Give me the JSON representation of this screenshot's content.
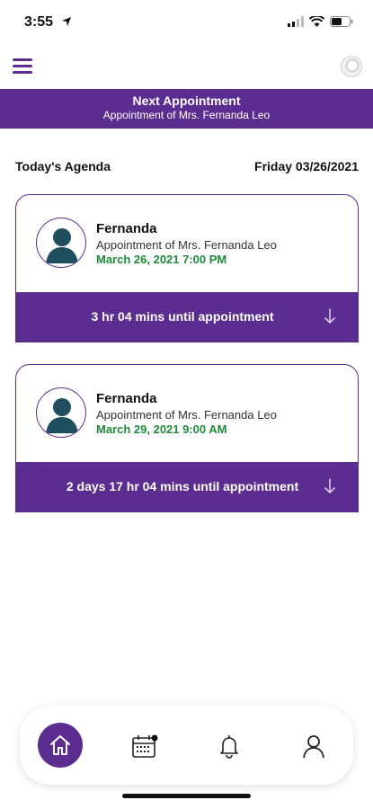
{
  "status_bar": {
    "time": "3:55"
  },
  "banner": {
    "title": "Next Appointment",
    "subtitle": "Appointment of Mrs. Fernanda Leo"
  },
  "agenda": {
    "label": "Today's Agenda",
    "date": "Friday 03/26/2021"
  },
  "appointments": [
    {
      "name": "Fernanda",
      "subtitle": "Appointment of Mrs. Fernanda Leo",
      "datetime": "March 26, 2021 7:00 PM",
      "countdown": "3 hr 04 mins until appointment"
    },
    {
      "name": "Fernanda",
      "subtitle": "Appointment of Mrs. Fernanda Leo",
      "datetime": "March 29, 2021 9:00 AM",
      "countdown": "2 days 17 hr 04 mins until appointment"
    }
  ],
  "nav": {
    "items": [
      {
        "icon": "home-icon",
        "active": true
      },
      {
        "icon": "calendar-icon",
        "active": false
      },
      {
        "icon": "bell-icon",
        "active": false
      },
      {
        "icon": "user-icon",
        "active": false
      }
    ]
  },
  "colors": {
    "accent": "#5c2d91",
    "date_green": "#1e8a3a",
    "avatar_fill": "#1f4e5f"
  }
}
